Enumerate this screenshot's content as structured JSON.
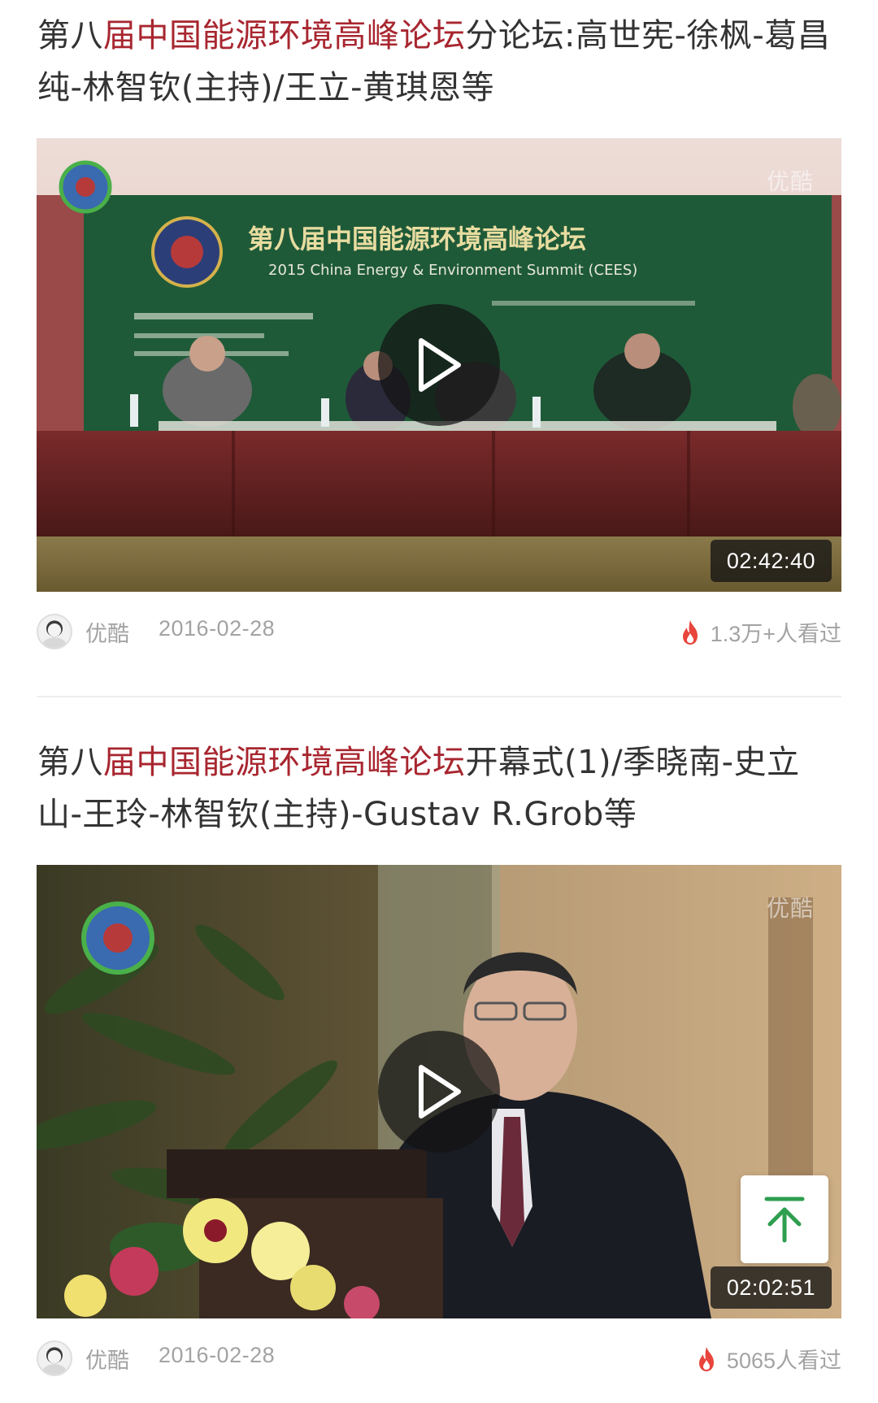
{
  "feed": [
    {
      "title_pre": "第八",
      "title_highlight": "届中国能源环境高峰论坛",
      "title_post": "分论坛:高世宪-徐枫-葛昌纯-林智钦(主持)/王立-黄琪恩等",
      "duration": "02:42:40",
      "watermark": "优酷",
      "source": "优酷",
      "date": "2016-02-28",
      "views": "1.3万+人看过",
      "banner_title": "第八届中国能源环境高峰论坛",
      "banner_subtitle": "2015 China Energy & Environment Summit (CEES)"
    },
    {
      "title_pre": "第八",
      "title_highlight": "届中国能源环境高峰论坛",
      "title_post": "开幕式(1)/季晓南-史立山-王玲-林智钦(主持)-Gustav R.Grob等",
      "duration": "02:02:51",
      "watermark": "优酷",
      "source": "优酷",
      "date": "2016-02-28",
      "views": "5065人看过"
    }
  ],
  "colors": {
    "highlight": "#a8262f",
    "meta_text": "#a3a3a3",
    "flame": "#e8453c",
    "back_to_top_arrow": "#2e9e4f"
  },
  "icons": {
    "play": "play-icon",
    "views": "flame-icon",
    "back_to_top": "arrow-up-to-top-icon",
    "avatar": "avatar-icon"
  }
}
